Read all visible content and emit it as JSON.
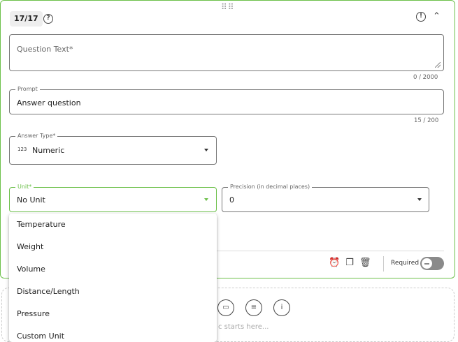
{
  "card": {
    "counter": "17/17",
    "help_glyph": "?",
    "alert_glyph": "!",
    "collapse_glyph": "⌃",
    "drag_glyph": "⠿⠿"
  },
  "question_text": {
    "placeholder": "Question Text*",
    "count": "0 / 2000"
  },
  "prompt": {
    "label": "Prompt",
    "value": "Answer question",
    "count": "15 / 200"
  },
  "answer_type": {
    "label": "Answer Type*",
    "icon_text": "123",
    "value": "Numeric"
  },
  "unit": {
    "label": "Unit*",
    "value": "No Unit",
    "options": [
      "Temperature",
      "Weight",
      "Volume",
      "Distance/Length",
      "Pressure",
      "Custom Unit"
    ]
  },
  "precision": {
    "label": "Precision (in decimal places)",
    "value": "0"
  },
  "toolbar": {
    "required_label": "Required",
    "icons": [
      "alarm-icon",
      "copy-icon",
      "trash-icon"
    ]
  },
  "add_zone": {
    "hint": "c starts here..."
  },
  "colors": {
    "accent": "#6cc04a",
    "toggle_off": "#8a8a8a"
  }
}
